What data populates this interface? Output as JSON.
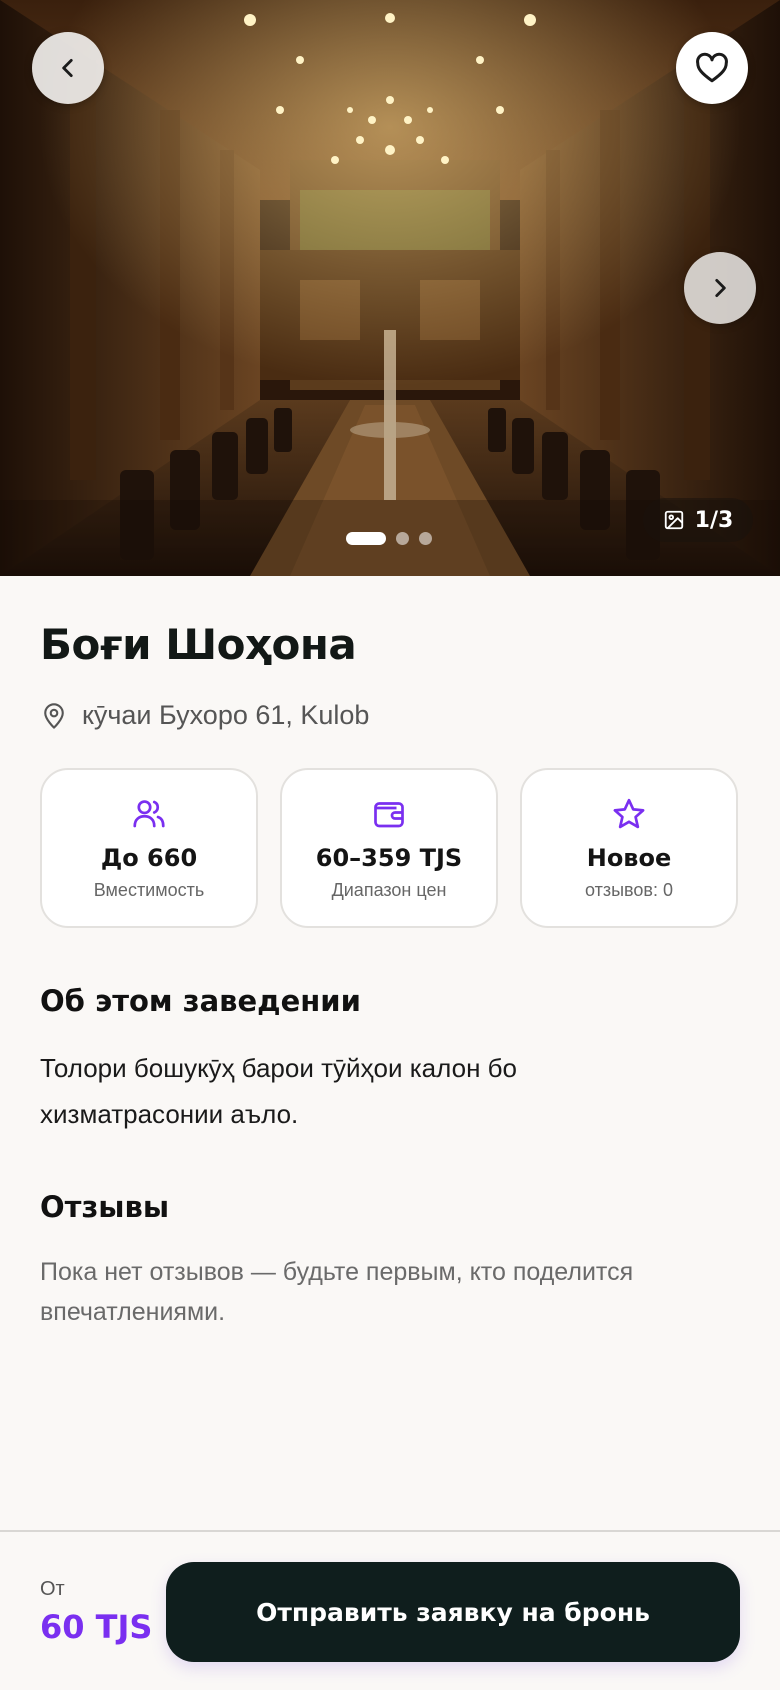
{
  "hero": {
    "counter": "1/3",
    "slides_total": 3,
    "active_slide": 1
  },
  "venue": {
    "name": "Боғи Шоҳона",
    "address": "кӯчаи Бухоро 61, Kulob"
  },
  "stats": [
    {
      "icon": "users-icon",
      "value": "До 660",
      "label": "Вместимость"
    },
    {
      "icon": "wallet-icon",
      "value": "60–359 TJS",
      "label": "Диапазон цен"
    },
    {
      "icon": "star-icon",
      "value": "Новое",
      "label": "отзывов: 0"
    }
  ],
  "about": {
    "heading": "Об этом заведении",
    "text": "Толори бошукӯҳ барои тӯйҳои калон бо хизматрасонии аъло."
  },
  "reviews": {
    "heading": "Отзывы",
    "empty_text": "Пока нет отзывов — будьте первым, кто поделится впечатлениями."
  },
  "footer": {
    "from_label": "От",
    "price": "60 TJS",
    "cta": "Отправить заявку на бронь"
  },
  "colors": {
    "accent": "#7a2ff0",
    "cta_bg": "#0f1e1d",
    "background": "#faf8f6"
  }
}
